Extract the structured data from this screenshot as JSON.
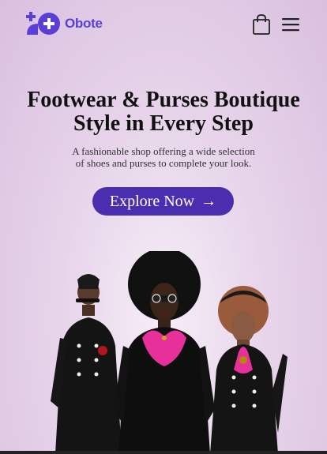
{
  "brand": {
    "name": "Obote",
    "color": "#5a3fd6"
  },
  "header": {
    "cart_icon": "shopping-bag-icon",
    "menu_icon": "hamburger-menu-icon"
  },
  "hero": {
    "title_line1": "Footwear & Purses Boutique",
    "title_line2": "Style in Every Step",
    "subtitle_line1": "A fashionable shop offering a wide selection",
    "subtitle_line2": "of shoes and purses to complete your look.",
    "cta_label": "Explore Now",
    "cta_arrow": "→",
    "cta_color": "#4a2eaf"
  },
  "colors": {
    "accent": "#4a2eaf",
    "background": "#e7d4ea",
    "fur_accent": "#e8309a"
  }
}
